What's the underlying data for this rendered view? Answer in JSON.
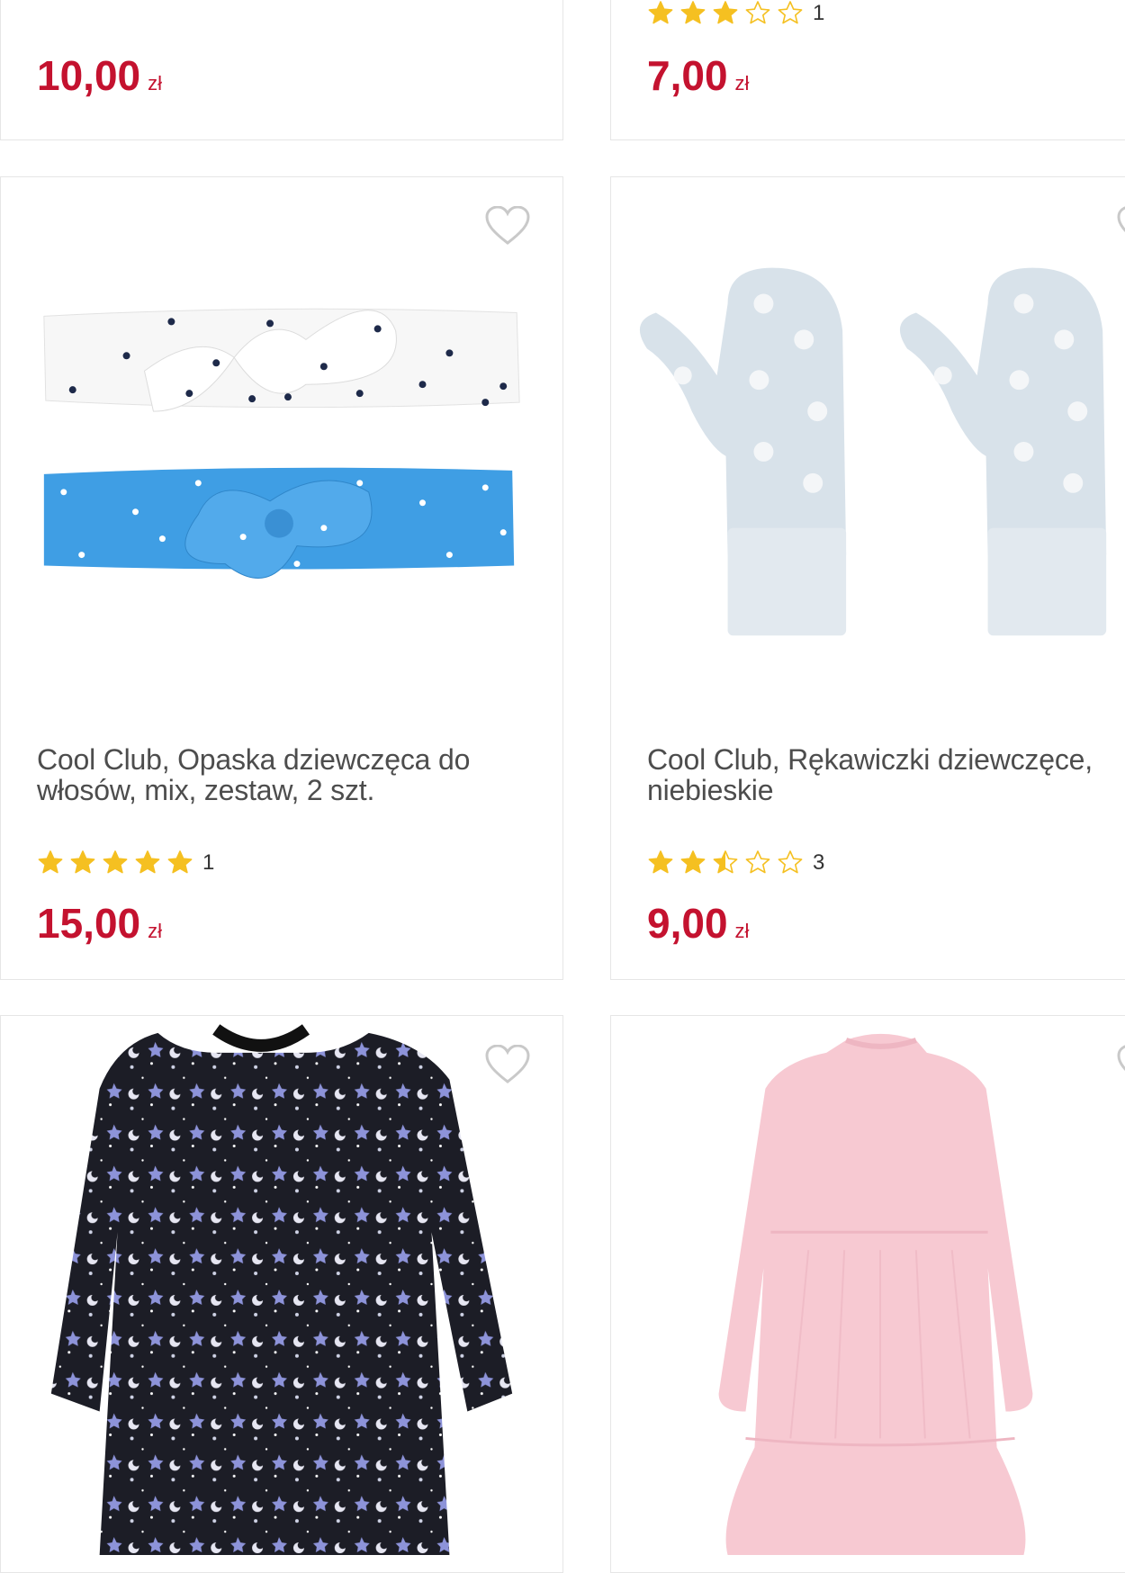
{
  "colors": {
    "price": "#c4122f",
    "star": "#f5c021",
    "border": "#e6e6e6"
  },
  "products": [
    {
      "title": "",
      "rating": null,
      "rating_count": "",
      "price": "10,00",
      "currency": "zł"
    },
    {
      "title": "",
      "rating": 3,
      "rating_count": "1",
      "price": "7,00",
      "currency": "zł"
    },
    {
      "title": "Cool Club, Opaska dziewczęca do włosów, mix, zestaw, 2 szt.",
      "rating": 5,
      "rating_count": "1",
      "price": "15,00",
      "currency": "zł",
      "image": "headbands-white-blue"
    },
    {
      "title": "Cool Club, Rękawiczki dziewczęce, niebieskie",
      "rating": 2.5,
      "rating_count": "3",
      "price": "9,00",
      "currency": "zł",
      "image": "mittens-light-blue"
    },
    {
      "title": "",
      "image": "dress-navy-stars"
    },
    {
      "title": "",
      "image": "dress-pink-velvet"
    }
  ],
  "icons": {
    "favorite": "heart-outline-icon",
    "star_full": "star-filled-icon",
    "star_empty": "star-outline-icon",
    "star_half": "star-half-icon"
  }
}
